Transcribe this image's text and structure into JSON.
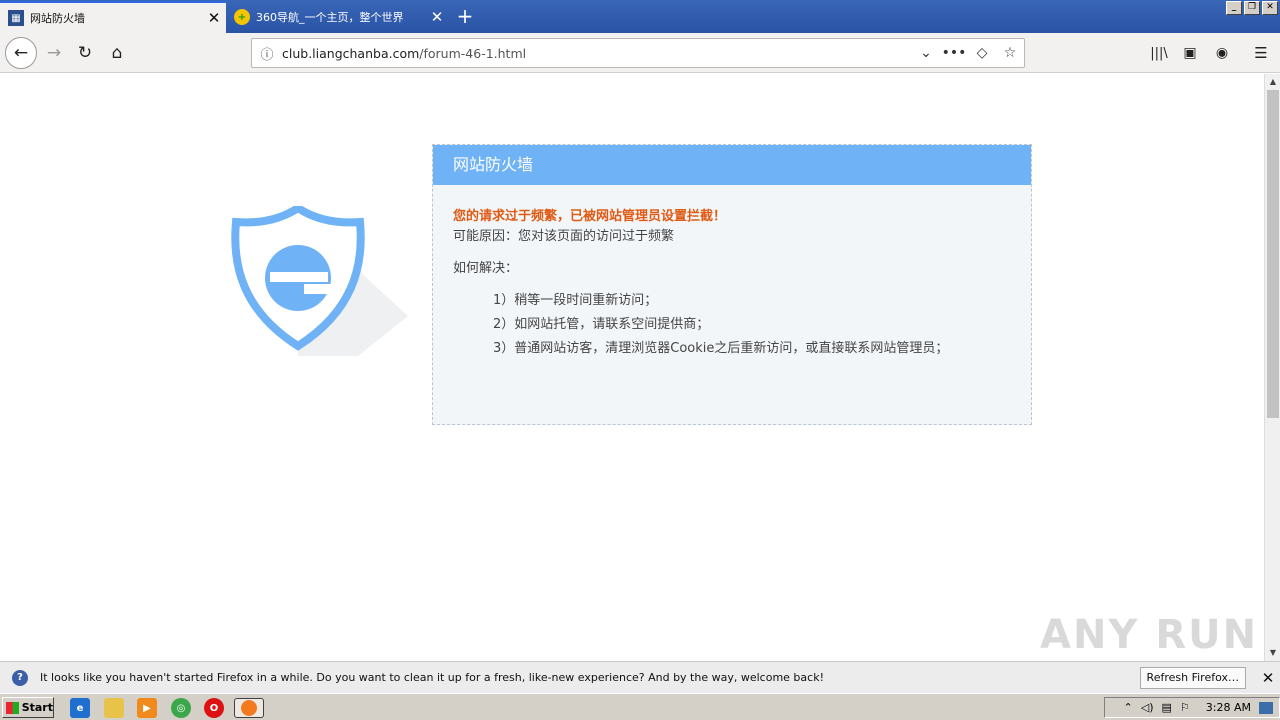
{
  "window": {
    "tabs": [
      {
        "title": "网站防火墙",
        "icon": "page-icon",
        "active": true
      },
      {
        "title": "360导航_一个主页，整个世界",
        "icon": "360-nav-icon",
        "active": false
      }
    ],
    "new_tab_label": "+",
    "min_label": "_",
    "restore_label": "❐",
    "close_label": "✕"
  },
  "navbar": {
    "back": "←",
    "forward": "→",
    "reload": "↻",
    "home": "⌂",
    "url_host": "club.liangchanba.com",
    "url_path": "/forum-46-1.html",
    "info": "ⓘ",
    "dropdown": "⌄",
    "more": "•••",
    "pocket": "◇",
    "bookmark": "☆",
    "library": "|||\\",
    "sidebar": "▣",
    "account": "◉",
    "menu": "☰"
  },
  "page": {
    "panel_title": "网站防火墙",
    "warning": "您的请求过于频繁，已被网站管理员设置拦截！",
    "reason": "可能原因：您对该页面的访问过于频繁",
    "howto": "如何解决：",
    "steps": [
      "1）稍等一段时间重新访问；",
      "2）如网站托管，请联系空间提供商；",
      "3）普通网站访客，清理浏览器Cookie之后重新访问，或直接联系网站管理员；"
    ],
    "accent": "#6fb2f5",
    "warn_color": "#e05a13"
  },
  "notification": {
    "message": "It looks like you haven't started Firefox in a while. Do you want to clean it up for a fresh, like-new experience? And by the way, welcome back!",
    "button": "Refresh Firefox…",
    "close": "✕"
  },
  "taskbar": {
    "start": "Start",
    "time": "3:28 AM"
  },
  "watermark": "ANY RUN"
}
